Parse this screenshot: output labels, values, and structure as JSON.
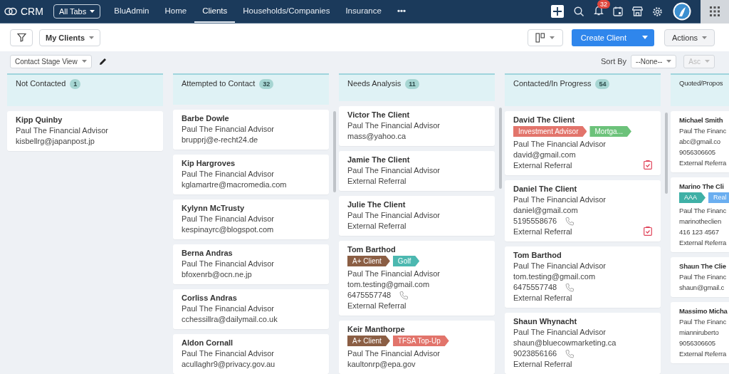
{
  "nav": {
    "brand": "CRM",
    "all_tabs": "All Tabs",
    "tabs": [
      {
        "label": "BluAdmin",
        "selected": false
      },
      {
        "label": "Home",
        "selected": false
      },
      {
        "label": "Clients",
        "selected": true
      },
      {
        "label": "Households/Companies",
        "selected": false
      },
      {
        "label": "Insurance",
        "selected": false
      }
    ],
    "more": "•••",
    "notification_count": "32"
  },
  "toolbar": {
    "view": "My Clients",
    "create": "Create Client",
    "actions": "Actions"
  },
  "subbar": {
    "stage_view": "Contact Stage View",
    "sort_label": "Sort By",
    "sort_field": "--None--",
    "sort_order": "Asc",
    "sort_order_disabled": true
  },
  "columns": [
    {
      "title": "Not Contacted",
      "count": "1",
      "cards": [
        {
          "name": "Kipp Quinby",
          "lines": [
            {
              "kind": "text",
              "text": "Paul The Financial Advisor"
            },
            {
              "kind": "text",
              "text": "kisbellrg@japanpost.jp"
            }
          ],
          "task": false
        }
      ]
    },
    {
      "title": "Attempted to Contact",
      "count": "32",
      "cards": [
        {
          "name": "Barbe Dowle",
          "lines": [
            {
              "kind": "text",
              "text": "Paul The Financial Advisor"
            },
            {
              "kind": "text",
              "text": "brupprj@e-recht24.de"
            }
          ],
          "task": false
        },
        {
          "name": "Kip Hargroves",
          "lines": [
            {
              "kind": "text",
              "text": "Paul The Financial Advisor"
            },
            {
              "kind": "text",
              "text": "kglamartre@macromedia.com"
            }
          ],
          "task": false
        },
        {
          "name": "Kylynn McTrusty",
          "lines": [
            {
              "kind": "text",
              "text": "Paul The Financial Advisor"
            },
            {
              "kind": "text",
              "text": "kespinayrc@blogspot.com"
            }
          ],
          "task": false
        },
        {
          "name": "Berna Andras",
          "lines": [
            {
              "kind": "text",
              "text": "Paul The Financial Advisor"
            },
            {
              "kind": "text",
              "text": "bfoxenrb@ocn.ne.jp"
            }
          ],
          "task": false
        },
        {
          "name": "Corliss Andras",
          "lines": [
            {
              "kind": "text",
              "text": "Paul The Financial Advisor"
            },
            {
              "kind": "text",
              "text": "cchessillra@dailymail.co.uk"
            }
          ],
          "task": false
        },
        {
          "name": "Aldon Cornall",
          "lines": [
            {
              "kind": "text",
              "text": "Paul The Financial Advisor"
            },
            {
              "kind": "text",
              "text": "acullaghr9@privacy.gov.au"
            }
          ],
          "task": false
        }
      ]
    },
    {
      "title": "Needs Analysis",
      "count": "11",
      "cards": [
        {
          "name": "Victor The Client",
          "lines": [
            {
              "kind": "text",
              "text": "Paul The Financial Advisor"
            },
            {
              "kind": "text",
              "text": "mass@yahoo.ca"
            }
          ],
          "task": false
        },
        {
          "name": "Jamie The Client",
          "lines": [
            {
              "kind": "text",
              "text": "Paul The Financial Advisor"
            },
            {
              "kind": "text",
              "text": "External Referral"
            }
          ],
          "task": false
        },
        {
          "name": "Julie The Client",
          "lines": [
            {
              "kind": "text",
              "text": "Paul The Financial Advisor"
            },
            {
              "kind": "text",
              "text": "External Referral"
            }
          ],
          "task": false
        },
        {
          "name": "Tom Barthod",
          "tags": [
            {
              "label": "A+ Client",
              "color": "#8b5e44"
            },
            {
              "label": "Golf",
              "color": "#4cb8b0"
            }
          ],
          "lines": [
            {
              "kind": "text",
              "text": "Paul The Financial Advisor"
            },
            {
              "kind": "text",
              "text": "tom.testing@gmail.com"
            },
            {
              "kind": "phone",
              "text": "6475557748"
            },
            {
              "kind": "text",
              "text": "External Referral"
            }
          ],
          "task": false
        },
        {
          "name": "Keir Manthorpe",
          "tags": [
            {
              "label": "A+ Client",
              "color": "#8b5e44"
            },
            {
              "label": "TFSA Top-Up",
              "color": "#e2746b"
            }
          ],
          "lines": [
            {
              "kind": "text",
              "text": "Paul The Financial Advisor"
            },
            {
              "kind": "text",
              "text": "kaultonrp@epa.gov"
            }
          ],
          "task": false
        }
      ]
    },
    {
      "title": "Contacted/In Progress",
      "count": "54",
      "cards": [
        {
          "name": "David The Client",
          "tags": [
            {
              "label": "Investment Advisor",
              "color": "#e2746b"
            },
            {
              "label": "Mortga...",
              "color": "#6cc27a"
            }
          ],
          "lines": [
            {
              "kind": "text",
              "text": "Paul The Financial Advisor"
            },
            {
              "kind": "text",
              "text": "david@gmail.com"
            },
            {
              "kind": "text",
              "text": "External Referral"
            }
          ],
          "task": true
        },
        {
          "name": "Daniel The Client",
          "lines": [
            {
              "kind": "text",
              "text": "Paul The Financial Advisor"
            },
            {
              "kind": "text",
              "text": "daniel@gmail.com"
            },
            {
              "kind": "phone",
              "text": "5195558676"
            },
            {
              "kind": "text",
              "text": "External Referral"
            }
          ],
          "task": true
        },
        {
          "name": "Tom Barthod",
          "lines": [
            {
              "kind": "text",
              "text": "Paul The Financial Advisor"
            },
            {
              "kind": "text",
              "text": "tom.testing@gmail.com"
            },
            {
              "kind": "phone",
              "text": "6475557748"
            },
            {
              "kind": "text",
              "text": "External Referral"
            }
          ],
          "task": false
        },
        {
          "name": "Shaun Whynacht",
          "lines": [
            {
              "kind": "text",
              "text": "Paul The Financial Advisor"
            },
            {
              "kind": "text",
              "text": "shaun@bluecowmarketing.ca"
            },
            {
              "kind": "phone",
              "text": "9023856166"
            },
            {
              "kind": "text",
              "text": "External Referral"
            }
          ],
          "task": false
        }
      ]
    },
    {
      "title": "Quoted/Propos",
      "cards": [
        {
          "name": "Michael Smith",
          "lines": [
            {
              "kind": "text",
              "text": "Paul The Financ"
            },
            {
              "kind": "text",
              "text": "abc@gmail.co"
            },
            {
              "kind": "text",
              "text": "9056306605"
            },
            {
              "kind": "text",
              "text": "External Referra"
            }
          ],
          "task": false
        },
        {
          "name": "Marino The Cli",
          "tags": [
            {
              "label": "AAA",
              "color": "#3fb0a6"
            },
            {
              "label": "Real",
              "color": "#6aaef0"
            }
          ],
          "lines": [
            {
              "kind": "text",
              "text": "Paul The Financ"
            },
            {
              "kind": "text",
              "text": "marinotheclien"
            },
            {
              "kind": "text",
              "text": "416 123 4567"
            },
            {
              "kind": "text",
              "text": "External Referra"
            }
          ],
          "task": false
        },
        {
          "name": "Shaun The Clie",
          "lines": [
            {
              "kind": "text",
              "text": "Paul The Financ"
            },
            {
              "kind": "text",
              "text": "shaun@gmail.c"
            }
          ],
          "task": false
        },
        {
          "name": "Massimo Micha",
          "lines": [
            {
              "kind": "text",
              "text": "Paul The Financ"
            },
            {
              "kind": "text",
              "text": "mianniruberto"
            },
            {
              "kind": "text",
              "text": "9056306605"
            },
            {
              "kind": "text",
              "text": "External Referra"
            }
          ],
          "task": false
        }
      ]
    }
  ]
}
